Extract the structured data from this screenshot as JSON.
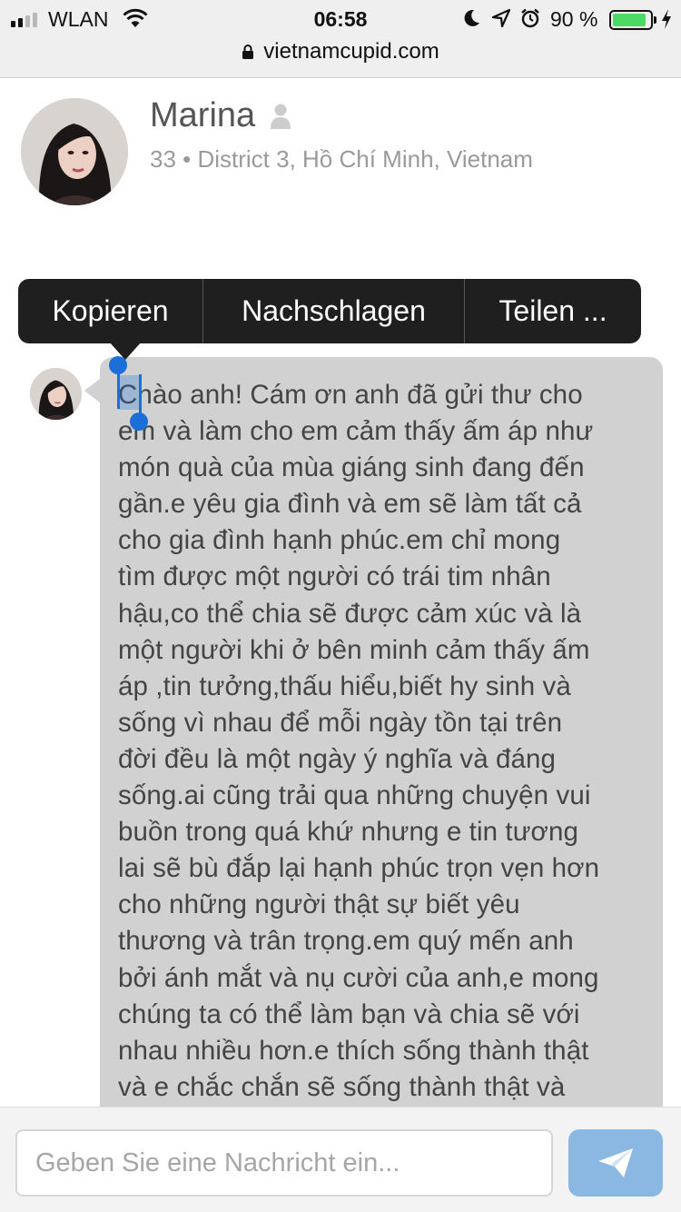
{
  "status_bar": {
    "carrier": "WLAN",
    "time": "06:58",
    "battery_percent": "90 %",
    "battery_level": 0.9,
    "signal_bars": 2,
    "icons": [
      "signal-icon",
      "wifi-icon",
      "moon-icon",
      "location-arrow-icon",
      "alarm-icon",
      "battery-icon",
      "charging-icon"
    ]
  },
  "browser": {
    "url": "vietnamcupid.com",
    "lock_icon": "lock-icon"
  },
  "profile": {
    "name": "Marina",
    "details": "33 • District 3, Hồ Chí Minh, Vietnam",
    "status_icon": "person-icon"
  },
  "context_menu": {
    "items": [
      "Kopieren",
      "Nachschlagen",
      "Teilen ..."
    ]
  },
  "message": {
    "text": "Chào anh! Cám ơn anh đã gửi thư cho\nem và làm cho em cảm thấy ấm áp như\nmón quà của mùa giáng sinh đang đến\ngần.e yêu gia đình và em sẽ làm tất cả\ncho gia đình hạnh phúc.em chỉ mong\ntìm được một người có trái tim nhân\nhậu,co thể chia sẽ được cảm xúc và là\nmột người khi ở bên minh cảm thấy ấm\náp ,tin tưởng,thấu hiểu,biết hy sinh và\nsống vì nhau để mỗi ngày tồn tại trên\nđời đều là một ngày ý nghĩa và đáng\nsống.ai cũng trải qua những chuyện vui\nbuồn trong quá khứ nhưng e tin tương\nlai sẽ bù đắp lại hạnh phúc trọn vẹn hơn\ncho những người thật sự biết yêu\nthương và trân trọng.em quý mến anh\nbởi ánh mắt và nụ cười của anh,e mong\nchúng ta có thể làm bạn và chia sẽ với\nnhau nhiều hơn.e thích sống thành thật\nvà e chắc chắn sẽ sống thành thật và",
    "selected_text": "C"
  },
  "composer": {
    "placeholder": "Geben Sie eine Nachricht ein...",
    "value": "",
    "send_icon": "paper-plane-icon"
  },
  "colors": {
    "bubble": "#d1d1d1",
    "selection": "#1a6fd8",
    "send_button": "#8ab8e2",
    "context_menu": "#1f1f1f",
    "battery_fill": "#4cd964"
  }
}
